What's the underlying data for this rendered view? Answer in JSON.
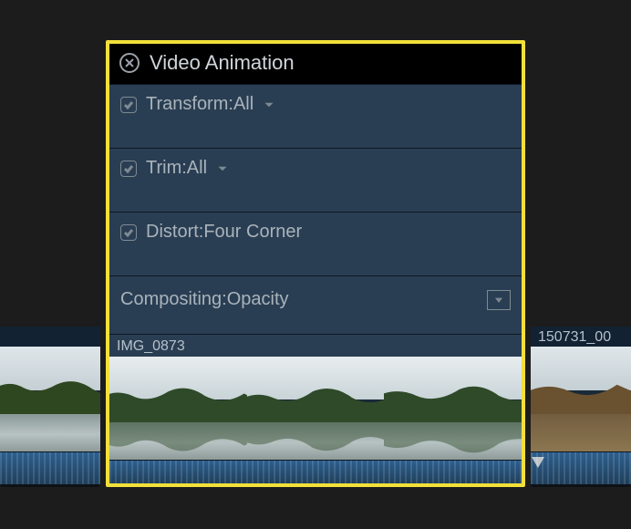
{
  "panel": {
    "title": "Video Animation",
    "rows": [
      {
        "label": "Transform:All",
        "checked": true,
        "has_dropdown": true
      },
      {
        "label": "Trim:All",
        "checked": true,
        "has_dropdown": true
      },
      {
        "label": "Distort:Four Corner",
        "checked": true,
        "has_dropdown": false
      }
    ],
    "compositing": {
      "label": "Compositing:Opacity"
    }
  },
  "clips": {
    "center": {
      "name": "IMG_0873"
    },
    "left": {
      "name": ""
    },
    "right": {
      "name": "150731_00"
    }
  }
}
